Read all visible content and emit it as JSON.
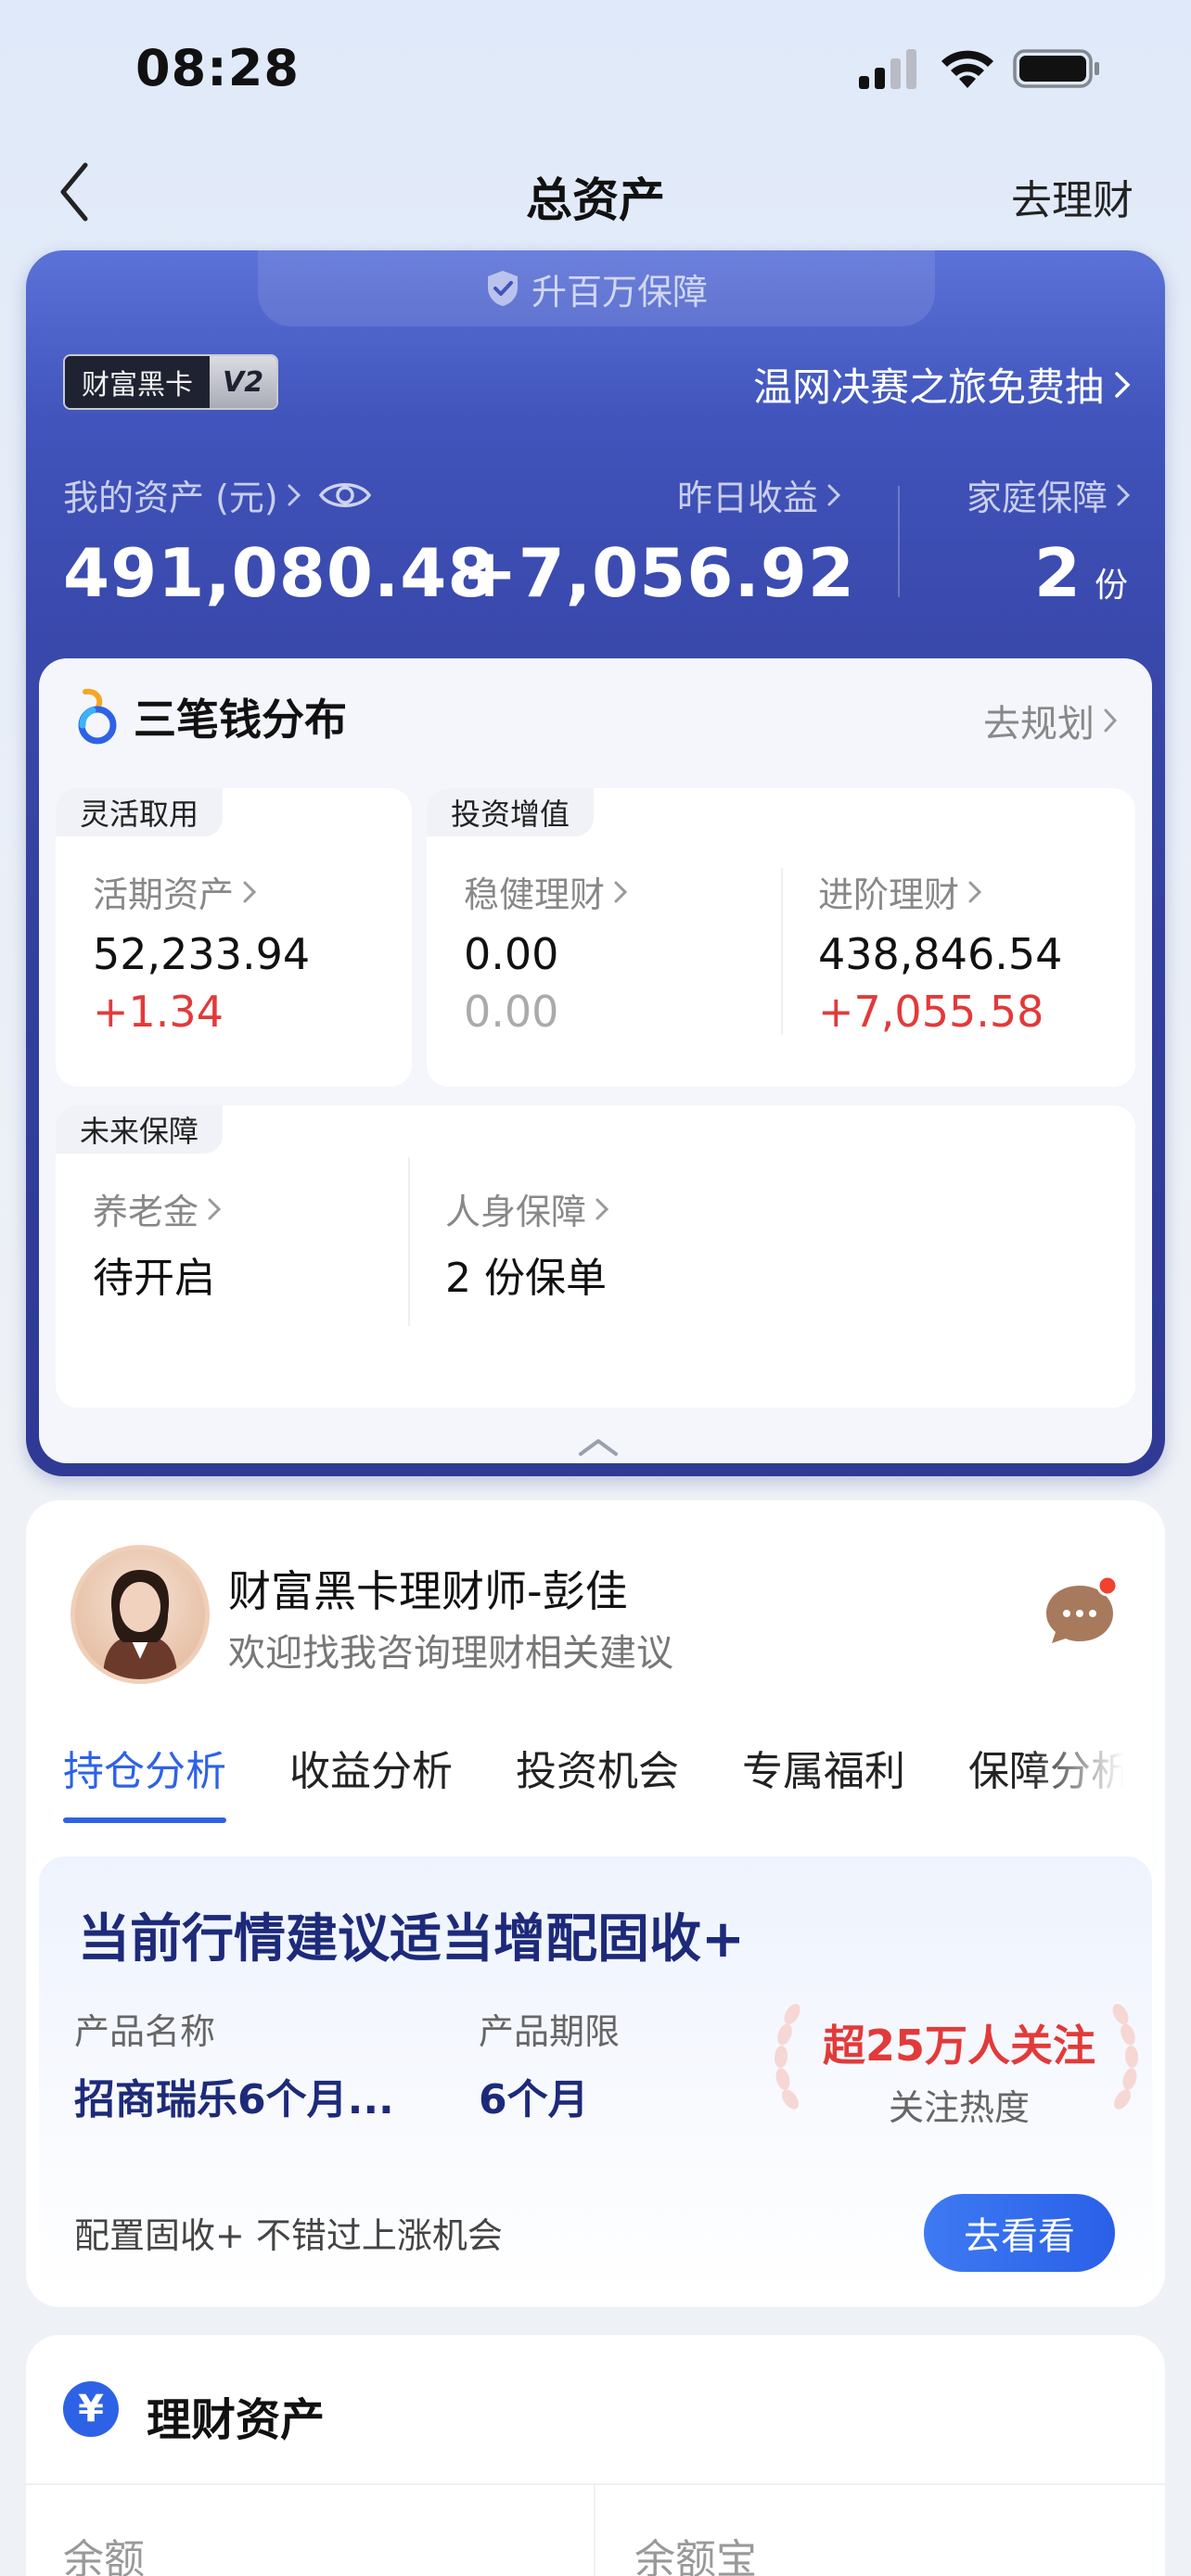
{
  "status_bar": {
    "time": "08:28"
  },
  "nav": {
    "title": "总资产",
    "right_link": "去理财"
  },
  "card": {
    "guard_tab": "升百万保障",
    "badge_name": "财富黑卡",
    "badge_level": "V2",
    "promo": "温网决赛之旅免费抽",
    "my_assets_label": "我的资产 (元)",
    "my_assets_value": "491,080.48",
    "yesterday_label": "昨日收益",
    "yesterday_value": "+7,056.92",
    "family_label": "家庭保障",
    "family_value": "2",
    "family_unit": "份"
  },
  "distribution": {
    "title": "三笔钱分布",
    "link": "去规划",
    "flexible": {
      "tag": "灵活取用",
      "label": "活期资产",
      "value": "52,233.94",
      "change": "+1.34"
    },
    "invest": {
      "tag": "投资增值",
      "steady_label": "稳健理财",
      "steady_value": "0.00",
      "steady_change": "0.00",
      "advanced_label": "进阶理财",
      "advanced_value": "438,846.54",
      "advanced_change": "+7,055.58"
    },
    "future": {
      "tag": "未来保障",
      "pension_label": "养老金",
      "pension_value": "待开启",
      "insurance_label": "人身保障",
      "insurance_value": "2 份保单"
    }
  },
  "advisor": {
    "name": "财富黑卡理财师-彭佳",
    "subtitle": "欢迎找我咨询理财相关建议",
    "tabs": [
      "持仓分析",
      "收益分析",
      "投资机会",
      "专属福利",
      "保障分析"
    ]
  },
  "recommendation": {
    "title": "当前行情建议适当增配固收+",
    "product_name_label": "产品名称",
    "product_name": "招商瑞乐6个月...",
    "term_label": "产品期限",
    "term": "6个月",
    "hot_value": "超25万人关注",
    "hot_label": "关注热度",
    "footer": "配置固收+ 不错过上涨机会",
    "button": "去看看"
  },
  "assets": {
    "icon_text": "¥",
    "title": "理财资产",
    "col1": "余额",
    "col2": "余额宝"
  },
  "colors": {
    "accent_blue": "#2e62e6",
    "card_blue": "#323f9c",
    "gain_red": "#e23a3a"
  }
}
